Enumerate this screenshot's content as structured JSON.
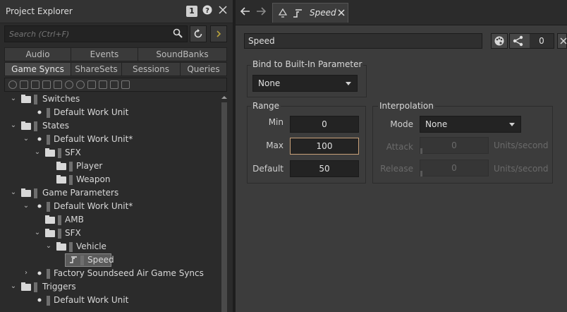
{
  "explorer": {
    "title": "Project Explorer",
    "badge": "1",
    "search_placeholder": "Search (Ctrl+F)",
    "tabs_row1": [
      "Audio",
      "Events",
      "SoundBanks"
    ],
    "tabs_row2": [
      "Game Syncs",
      "ShareSets",
      "Sessions",
      "Queries"
    ],
    "tree": [
      "Switches",
      "Default Work Unit",
      "States",
      "Default Work Unit*",
      "SFX",
      "Player",
      "Weapon",
      "Game Parameters",
      "Default Work Unit*",
      "AMB",
      "SFX",
      "Vehicle",
      "Speed",
      "Factory Soundseed Air Game Syncs",
      "Triggers",
      "Default Work Unit"
    ]
  },
  "editor": {
    "tab_name": "Speed",
    "object_name": "Speed",
    "share_count": "0",
    "bind_group": {
      "title": "Bind to Built-In Parameter",
      "value": "None"
    },
    "range": {
      "title": "Range",
      "min_label": "Min",
      "min_value": "0",
      "max_label": "Max",
      "max_value": "100",
      "default_label": "Default",
      "default_value": "50"
    },
    "interpolation": {
      "title": "Interpolation",
      "mode_label": "Mode",
      "mode_value": "None",
      "attack_label": "Attack",
      "attack_value": "0",
      "release_label": "Release",
      "release_value": "0",
      "units": "Units/second"
    }
  }
}
